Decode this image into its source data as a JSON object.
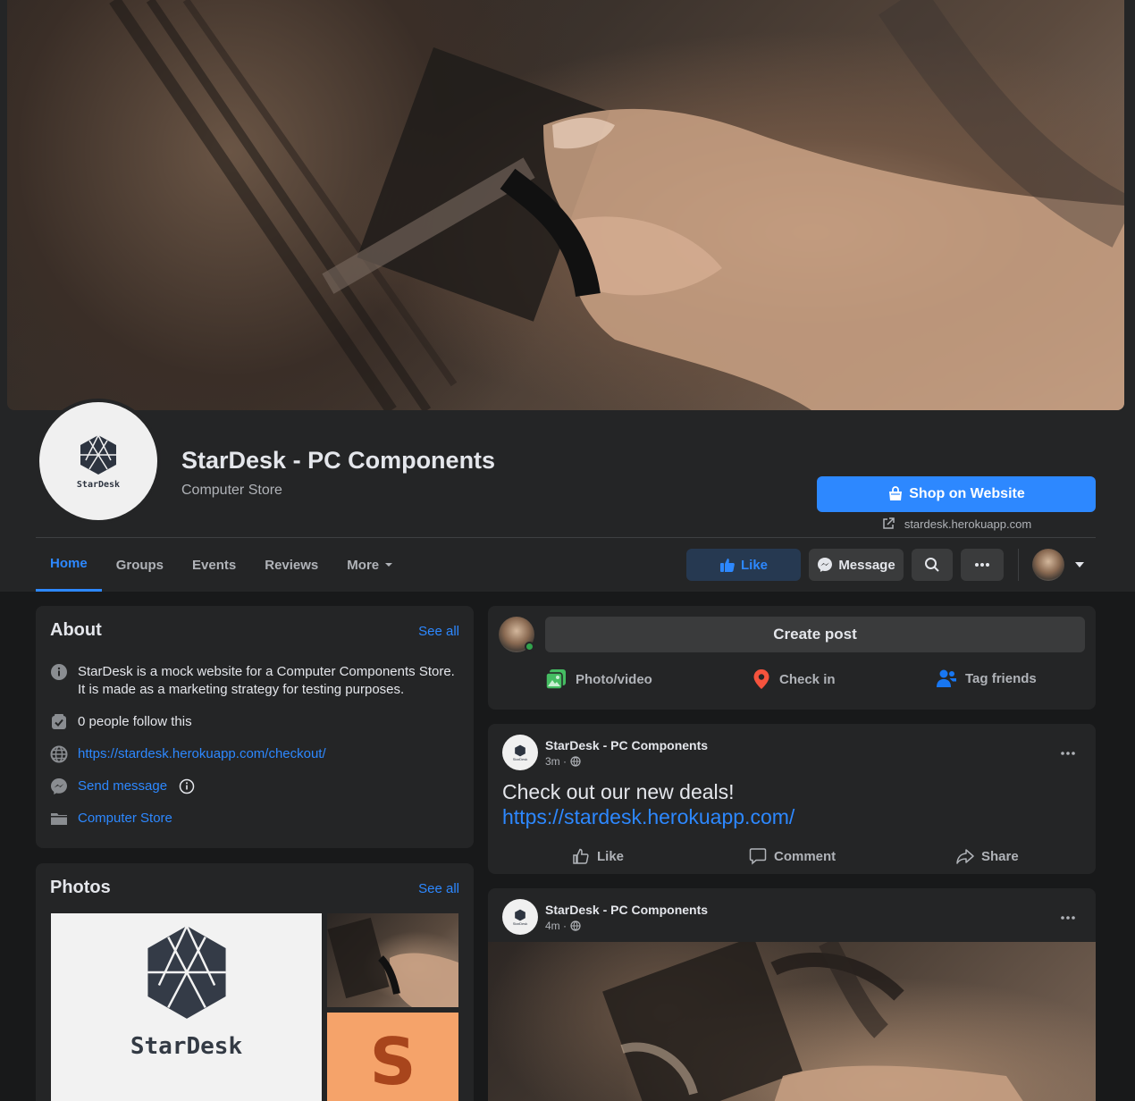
{
  "page": {
    "name": "StarDesk - PC Components",
    "category": "Computer Store",
    "logo_text": "StarDesk"
  },
  "header": {
    "shop_button": "Shop on Website",
    "website": "stardesk.herokuapp.com",
    "tabs": [
      "Home",
      "Groups",
      "Events",
      "Reviews",
      "More"
    ],
    "like_button": "Like",
    "message_button": "Message"
  },
  "about": {
    "title": "About",
    "see_all": "See all",
    "description": "StarDesk is a mock website for a Computer Components Store. It is made as a marketing strategy for testing purposes.",
    "followers": "0 people follow this",
    "url": "https://stardesk.herokuapp.com/checkout/",
    "send_message": "Send message",
    "category": "Computer Store"
  },
  "photos": {
    "title": "Photos",
    "see_all": "See all",
    "logo_text": "StarDesk",
    "letter_tile": "S"
  },
  "create_post": {
    "button": "Create post",
    "actions": [
      "Photo/video",
      "Check in",
      "Tag friends"
    ]
  },
  "posts": [
    {
      "author": "StarDesk - PC Components",
      "time": "3m ·",
      "text": "Check out our new deals!",
      "link": "https://stardesk.herokuapp.com/",
      "actions": [
        "Like",
        "Comment",
        "Share"
      ]
    },
    {
      "author": "StarDesk - PC Components",
      "time": "4m ·"
    }
  ],
  "colors": {
    "accent": "#2d88ff",
    "background": "#18191a",
    "card": "#242526",
    "button": "#3a3b3c",
    "text_secondary": "#b0b3b8"
  },
  "icons": [
    "shopping-bag-icon",
    "external-link-icon",
    "caret-down-icon",
    "thumbs-up-icon",
    "messenger-icon",
    "search-icon",
    "dots-icon",
    "info-icon",
    "follow-icon",
    "globe-icon",
    "folder-icon",
    "photo-icon",
    "location-pin-icon",
    "tag-friends-icon",
    "comment-icon",
    "share-icon"
  ]
}
